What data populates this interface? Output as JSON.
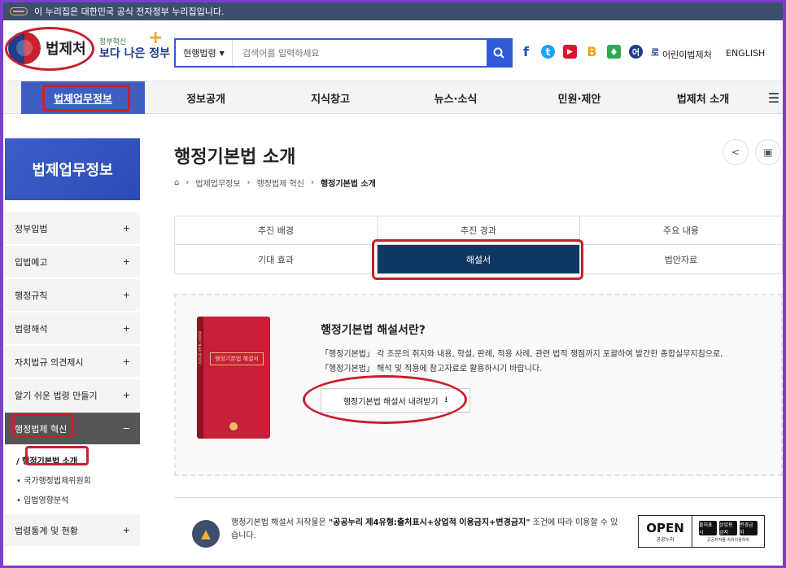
{
  "gov_banner": {
    "text": "이 누리집은 대한민국 공식 전자정부 누리집입니다."
  },
  "header": {
    "logo_text": "법제처",
    "slogan_small": "정부혁신",
    "slogan_big": "보다 나은 정부",
    "search": {
      "scope": "현행법령",
      "placeholder": "검색어를 입력하세요"
    },
    "social": {
      "facebook": "f",
      "twitter": "t",
      "youtube": "▶",
      "blog": "B",
      "kakao": "♦",
      "kids_icon": "어",
      "kids_tail": "로",
      "colors": {
        "facebook": "#1a56b0",
        "twitter": "#1da1f2",
        "youtube": "#e1122c",
        "blog": "#f1a40d",
        "kakao": "#2fa84f",
        "kids": "#1f3d8a"
      }
    },
    "kids_link": "어린이법제처",
    "english_link": "ENGLISH"
  },
  "gnb": {
    "items": [
      "법제업무정보",
      "정보공개",
      "지식창고",
      "뉴스·소식",
      "민원·제안",
      "법제처 소개"
    ],
    "menu_icon": "hamburger-icon"
  },
  "sidebar": {
    "title": "법제업무정보",
    "items": [
      {
        "label": "정부입법",
        "icon": "+"
      },
      {
        "label": "입법예고",
        "icon": "+"
      },
      {
        "label": "행정규칙",
        "icon": "+"
      },
      {
        "label": "법령해석",
        "icon": "+"
      },
      {
        "label": "자치법규 의견제시",
        "icon": "+"
      },
      {
        "label": "알기 쉬운 법령 만들기",
        "icon": "+"
      },
      {
        "label": "행정법제 혁신",
        "icon": "−"
      },
      {
        "label": "법령통계 및 현황",
        "icon": "+"
      }
    ],
    "sub_items": [
      "행정기본법 소개",
      "국가행정법제위원회",
      "입법영향분석"
    ]
  },
  "page": {
    "title": "행정기본법 소개",
    "breadcrumb": [
      "법제업무정보",
      "행정법제 혁신",
      "행정기본법 소개"
    ]
  },
  "tabs": [
    "추진 배경",
    "추진 경과",
    "주요 내용",
    "기대 효과",
    "해설서",
    "법안자료"
  ],
  "content": {
    "heading": "행정기본법 해설서란?",
    "desc1": "「행정기본법」 각 조문의 취지와 내용, 학설, 판례, 적용 사례, 관련 법적 쟁점까지 포괄하여 발간한 종합실무지침으로,",
    "desc2": "「행정기본법」 해석 및 적용에 참고자료로 활용하시기 바랍니다.",
    "download_label": "행정기본법 해설서 내려받기",
    "book_label": "행정기본법 해설서",
    "book_spine": "행정기본법 해설서"
  },
  "notice": {
    "prefix": "행정기본법 해설서 저작물은 ",
    "bold": "\"공공누리 제4유형:출처표시+상업적 이용금지+변경금지\"",
    "suffix": " 조건에 따라 이용할 수 있습니다."
  },
  "open_badge": {
    "label": "OPEN",
    "sub": "공공누리",
    "icons": [
      "출처표시",
      "상업용금지",
      "변경금지"
    ],
    "caption": "공공저작물 자유이용허락"
  }
}
